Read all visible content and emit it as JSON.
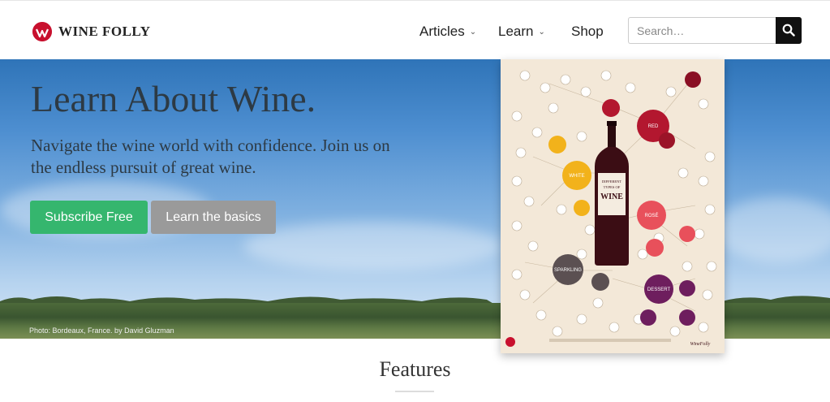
{
  "brand": {
    "name": "WINE FOLLY",
    "color": "#c8102e"
  },
  "nav": {
    "items": [
      {
        "label": "Articles",
        "has_dropdown": true
      },
      {
        "label": "Learn",
        "has_dropdown": true
      },
      {
        "label": "Shop",
        "has_dropdown": false
      }
    ],
    "chevron": "⌄"
  },
  "search": {
    "placeholder": "Search…",
    "icon": "search-icon"
  },
  "hero": {
    "title": "Learn About Wine.",
    "subtitle": "Navigate the wine world with confidence. Join us on the endless pursuit of great wine.",
    "primary_button": "Subscribe Free",
    "secondary_button": "Learn the basics",
    "photo_credit": "Photo: Bordeaux, France. by David Gluzman",
    "primary_color": "#35b66e",
    "secondary_color": "#9a9a9a"
  },
  "poster": {
    "bottle_label_line1": "DIFFERENT",
    "bottle_label_line2": "TYPES OF",
    "bottle_label_line3": "WINE",
    "nodes": {
      "red": "RED",
      "white": "WHITE",
      "rose": "ROSÉ",
      "sparkling": "SPARKLING",
      "dessert": "DESSERT"
    },
    "node_colors": {
      "red": "#b3172f",
      "white": "#f2b21b",
      "rose": "#e8505b",
      "sparkling": "#5b5052",
      "dessert": "#6e1e5e"
    },
    "signature": "WineFolly"
  },
  "features": {
    "title": "Features"
  }
}
